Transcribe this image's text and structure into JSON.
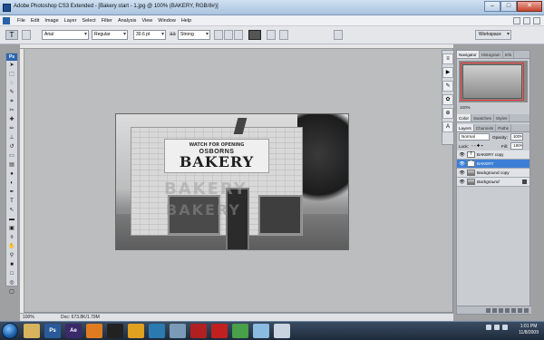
{
  "window": {
    "title": "Adobe Photoshop CS3 Extended - [Bakery start - 1.jpg @ 100% (BAKERY, RGB/8#)]",
    "controls": {
      "minimize": "–",
      "maximize": "□",
      "close": "✕"
    }
  },
  "menu": [
    "File",
    "Edit",
    "Image",
    "Layer",
    "Select",
    "Filter",
    "Analysis",
    "View",
    "Window",
    "Help"
  ],
  "options_bar": {
    "tool_icon": "text-tool-icon",
    "font_family": "Arial",
    "font_style": "Regular",
    "font_size": "30.6 pt",
    "aa_label": "aa",
    "anti_alias": "Strong",
    "workspace_label": "Workspace"
  },
  "toolbox": {
    "header": "Ps",
    "tools": [
      "move",
      "marquee",
      "lasso",
      "quick-select",
      "crop",
      "slice",
      "healing",
      "brush",
      "stamp",
      "history-brush",
      "eraser",
      "gradient",
      "blur",
      "dodge",
      "pen",
      "type",
      "path-select",
      "shape",
      "notes",
      "eyedropper",
      "hand",
      "zoom",
      "foreground-color",
      "background-color",
      "quick-mask",
      "screen-mode"
    ]
  },
  "document": {
    "sign_line1": "WATCH FOR OPENING",
    "sign_line2": "OSBORNS",
    "sign_line3": "BAKERY",
    "overlay_text_1": "BAKERY",
    "overlay_text_2": "BAKERY"
  },
  "status": {
    "zoom": "100%",
    "doc": "Doc: 673.8K/1.79M"
  },
  "panels": {
    "navigator_tabs": [
      "Navigator",
      "Histogram",
      "Info"
    ],
    "navigator_zoom": "100%",
    "color_tabs": [
      "Color",
      "Swatches",
      "Styles"
    ],
    "layer_tabs": [
      "Layers",
      "Channels",
      "Paths"
    ],
    "blend_mode": "Normal",
    "opacity_label": "Opacity:",
    "opacity": "100%",
    "lock_label": "Lock:",
    "fill_label": "Fill:",
    "fill": "100%",
    "layers": [
      {
        "name": "BAKERY copy",
        "type": "text",
        "selected": false
      },
      {
        "name": "BAKERY",
        "type": "text",
        "selected": true
      },
      {
        "name": "Background copy",
        "type": "image",
        "selected": false
      },
      {
        "name": "Background",
        "type": "image",
        "selected": false,
        "locked": true
      }
    ]
  },
  "taskbar": {
    "apps": [
      "explorer",
      "Ps",
      "Ae",
      "firefox",
      "bw",
      "app6",
      "app7",
      "app8",
      "app9",
      "app10",
      "app11",
      "app12",
      "app13"
    ],
    "time": "1:01 PM",
    "date": "11/8/2009"
  },
  "colors": {
    "accent": "#3d7fd6",
    "selection_red": "#e23030",
    "taskbar": "#2a3a4e"
  }
}
